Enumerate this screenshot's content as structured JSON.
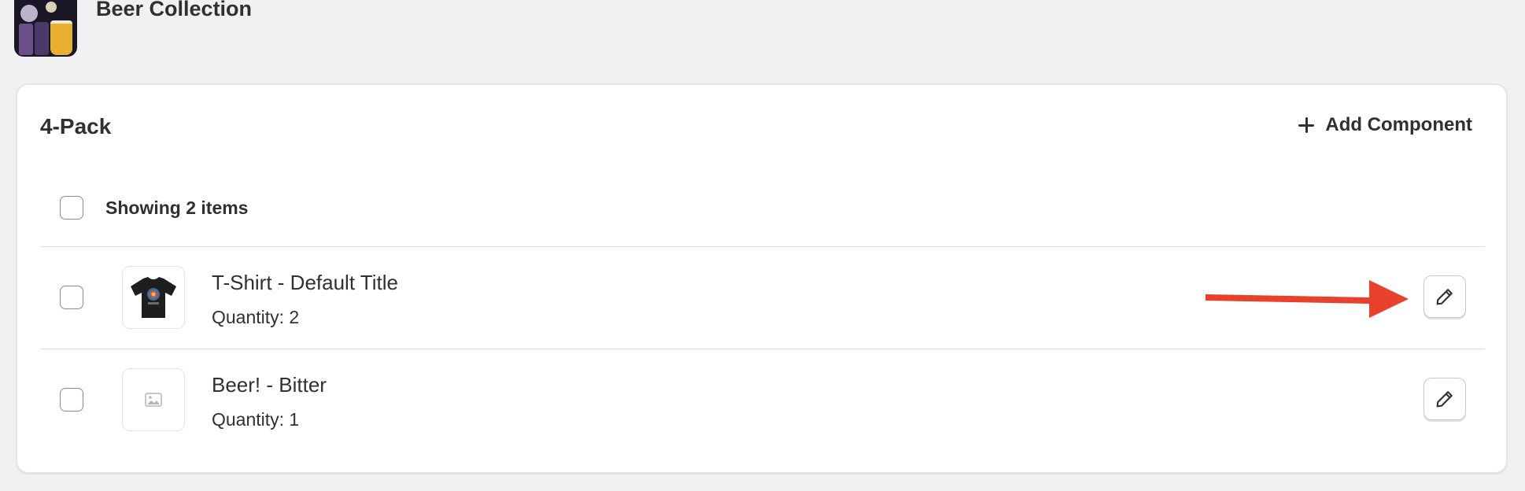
{
  "header": {
    "collection_title": "Beer Collection"
  },
  "card": {
    "title": "4-Pack",
    "add_component_label": "Add Component",
    "select_all_label": "Showing 2 items"
  },
  "items": [
    {
      "title": "T-Shirt - Default Title",
      "quantity": "Quantity: 2",
      "thumbnail": "t-shirt-image"
    },
    {
      "title": "Beer! - Bitter",
      "quantity": "Quantity: 1",
      "thumbnail": "image-placeholder-icon"
    }
  ],
  "annotation": {
    "color": "#e8412c",
    "points_to": "edit-button"
  },
  "colors": {
    "background": "#f1f1f1",
    "card": "#ffffff",
    "text": "#303030",
    "annotation_arrow": "#e8412c"
  }
}
